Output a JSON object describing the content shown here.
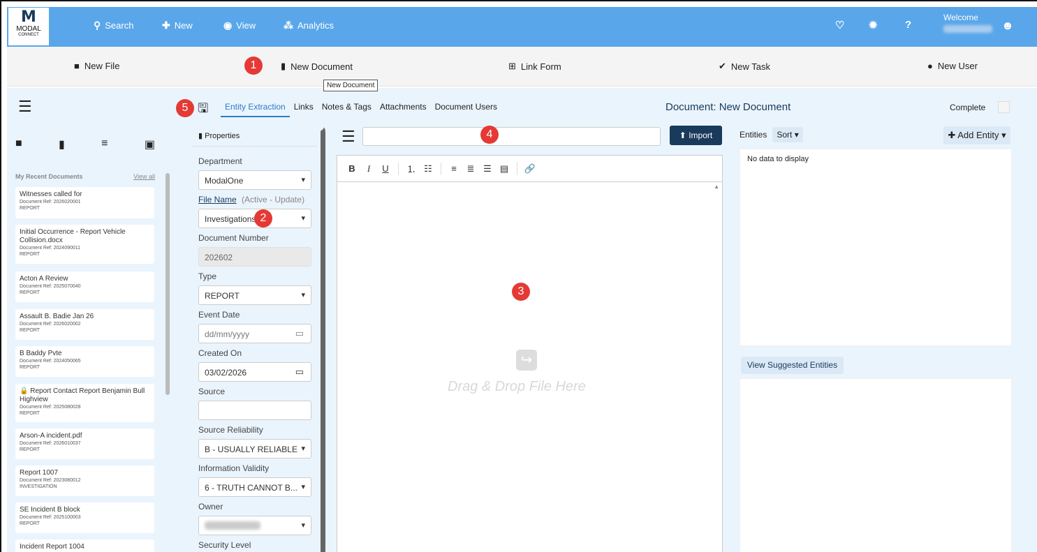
{
  "topbar": {
    "logo_main": "M",
    "logo_title": "MODAL",
    "logo_sub": "CONNECT",
    "nav": [
      {
        "icon": "search-icon",
        "glyph": "🔍",
        "label": "Search"
      },
      {
        "icon": "plus-icon",
        "glyph": "✚",
        "label": "New"
      },
      {
        "icon": "eye-icon",
        "glyph": "◉",
        "label": "View"
      },
      {
        "icon": "sitemap-icon",
        "glyph": "⁂",
        "label": "Analytics"
      }
    ],
    "welcome": "Welcome"
  },
  "actions": [
    {
      "icon": "briefcase-icon",
      "label": "New File"
    },
    {
      "icon": "file-icon",
      "label": "New Document"
    },
    {
      "icon": "plus-square-icon",
      "label": "Link Form"
    },
    {
      "icon": "check-icon",
      "label": "New Task"
    },
    {
      "icon": "user-icon",
      "label": "New User"
    }
  ],
  "tooltip": "New Document",
  "badges": [
    "1",
    "2",
    "3",
    "4",
    "5"
  ],
  "sidebar": {
    "recent_title": "My Recent Documents",
    "view_all": "View all",
    "items": [
      {
        "title": "Witnesses called for",
        "ref": "Document Ref: 2026020001",
        "type": "REPORT"
      },
      {
        "title": "Initial Occurrence - Report Vehicle Collision.docx",
        "ref": "Document Ref: 2024090011",
        "type": "REPORT"
      },
      {
        "title": "Acton A Review",
        "ref": "Document Ref: 2025070040",
        "type": "REPORT"
      },
      {
        "title": "Assault B. Badie Jan 26",
        "ref": "Document Ref: 2026020002",
        "type": "REPORT"
      },
      {
        "title": "B Baddy Pvte",
        "ref": "Document Ref: 2024050065",
        "type": "REPORT"
      },
      {
        "title": "🔒 Report Contact Report Benjamin Bull Highview",
        "ref": "Document Ref: 2025080028",
        "type": "REPORT"
      },
      {
        "title": "Arson-A incident.pdf",
        "ref": "Document Ref: 2026010037",
        "type": "REPORT"
      },
      {
        "title": "Report 1007",
        "ref": "Document Ref: 2023080012",
        "type": "INVESTIGATION"
      },
      {
        "title": "SE Incident B block",
        "ref": "Document Ref: 2025100003",
        "type": "REPORT"
      },
      {
        "title": "Incident Report 1004",
        "ref": "",
        "type": ""
      }
    ]
  },
  "tabs": [
    "Entity Extraction",
    "Links",
    "Notes & Tags",
    "Attachments",
    "Document Users"
  ],
  "doc_title": "Document: New Document",
  "complete_label": "Complete",
  "properties": {
    "header": "Properties",
    "department_label": "Department",
    "department_value": "ModalOne",
    "file_name_label": "File Name",
    "file_name_note": "(Active - Update)",
    "file_name_value": "Investigations",
    "doc_number_label": "Document Number",
    "doc_number_value": "202602",
    "type_label": "Type",
    "type_value": "REPORT",
    "event_date_label": "Event Date",
    "event_date_value": "dd/mm/yyyy",
    "created_label": "Created On",
    "created_value": "03/02/2026",
    "source_label": "Source",
    "source_value": "",
    "reliability_label": "Source Reliability",
    "reliability_value": "B - USUALLY RELIABLE",
    "validity_label": "Information Validity",
    "validity_value": "6 - TRUTH CANNOT B...",
    "owner_label": "Owner",
    "security_label": "Security Level"
  },
  "editor": {
    "import_label": "Import",
    "toolbar": [
      "B",
      "I",
      "U",
      "ordered-list",
      "bullet-list",
      "align-left",
      "align-center",
      "align-right",
      "align-justify",
      "link"
    ],
    "drop_text": "Drag & Drop File Here"
  },
  "entities": {
    "label": "Entities",
    "sort_label": "Sort ▾",
    "add_label": "Add Entity ▾",
    "empty_text": "No data to display",
    "suggested_label": "View Suggested Entities"
  }
}
